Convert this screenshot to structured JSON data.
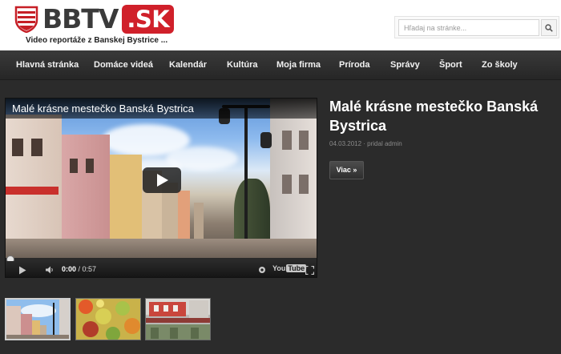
{
  "header": {
    "logo_main": "BBTV",
    "logo_suffix": ".SK",
    "tagline": "Video reportáže z Banskej Bystrice ...",
    "search_placeholder": "Hľadaj na stránke..."
  },
  "nav": {
    "items": [
      "Hlavná stránka",
      "Domáce videá",
      "Kalendár",
      "Kultúra",
      "Moja firma",
      "Príroda",
      "Správy",
      "Šport",
      "Zo školy"
    ]
  },
  "video": {
    "title": "Malé krásne mestečko Banská  Bystrica",
    "time_current": "0:00",
    "time_separator": " / ",
    "time_total": "0:57",
    "logo_you": "You",
    "logo_tube": "Tube"
  },
  "article": {
    "title": "Malé krásne mestečko Banská Bystrica",
    "date": "04.03.2012",
    "separator": " · ",
    "author": "pridal admin",
    "more_label": "Viac »"
  },
  "colors": {
    "brand_red": "#d0202a",
    "background": "#2b2b2b",
    "nav": "#2f2f2f"
  },
  "icons": [
    "shield-logo",
    "search-icon",
    "play-icon",
    "volume-icon",
    "settings-icon",
    "fullscreen-icon"
  ]
}
